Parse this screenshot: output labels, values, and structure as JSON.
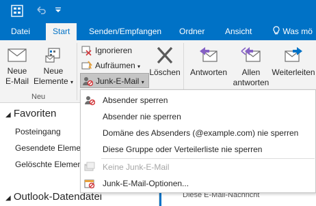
{
  "tabs": {
    "datei": "Datei",
    "start": "Start",
    "senden": "Senden/Empfangen",
    "ordner": "Ordner",
    "ansicht": "Ansicht",
    "tellme": "Was mö"
  },
  "ribbon": {
    "neue_email_line1": "Neue",
    "neue_email_line2": "E-Mail",
    "neue_elemente_line1": "Neue",
    "neue_elemente_line2": "Elemente",
    "group_neu": "Neu",
    "ignorieren": "Ignorieren",
    "aufraeumen": "Aufräumen",
    "junk": "Junk-E-Mail",
    "loeschen": "Löschen",
    "antworten": "Antworten",
    "allen_line1": "Allen",
    "allen_line2": "antworten",
    "weiterleiten": "Weiterleiten"
  },
  "nav": {
    "favoriten": "Favoriten",
    "posteingang": "Posteingang",
    "gesendete": "Gesendete Elemente",
    "geloeschte": "Gelöschte Elemente",
    "datendatei": "Outlook-Datendatei"
  },
  "message_preview": "Diese E-Mail-Nachricht",
  "junk_menu": {
    "items": [
      {
        "label": "Absender sperren",
        "enabled": true
      },
      {
        "label": "Absender nie sperren",
        "enabled": true
      },
      {
        "label": "Domäne des Absenders (@example.com) nie sperren",
        "enabled": true
      },
      {
        "label": "Diese Gruppe oder Verteilerliste nie sperren",
        "enabled": true
      },
      {
        "label": "Keine Junk-E-Mail",
        "enabled": false
      },
      {
        "label": "Junk-E-Mail-Optionen...",
        "enabled": true
      }
    ]
  },
  "colors": {
    "accent": "#0072c6",
    "ribbon_bg": "#f3f3f3",
    "block_red": "#d13438"
  },
  "icons": [
    "outlook-app-icon",
    "undo-icon",
    "quick-access-dropdown-icon",
    "lightbulb-icon",
    "new-email-icon",
    "new-items-icon",
    "ignore-icon",
    "cleanup-icon",
    "junk-icon",
    "delete-icon",
    "reply-icon",
    "reply-all-icon",
    "forward-icon",
    "collapse-arrow-icon"
  ]
}
